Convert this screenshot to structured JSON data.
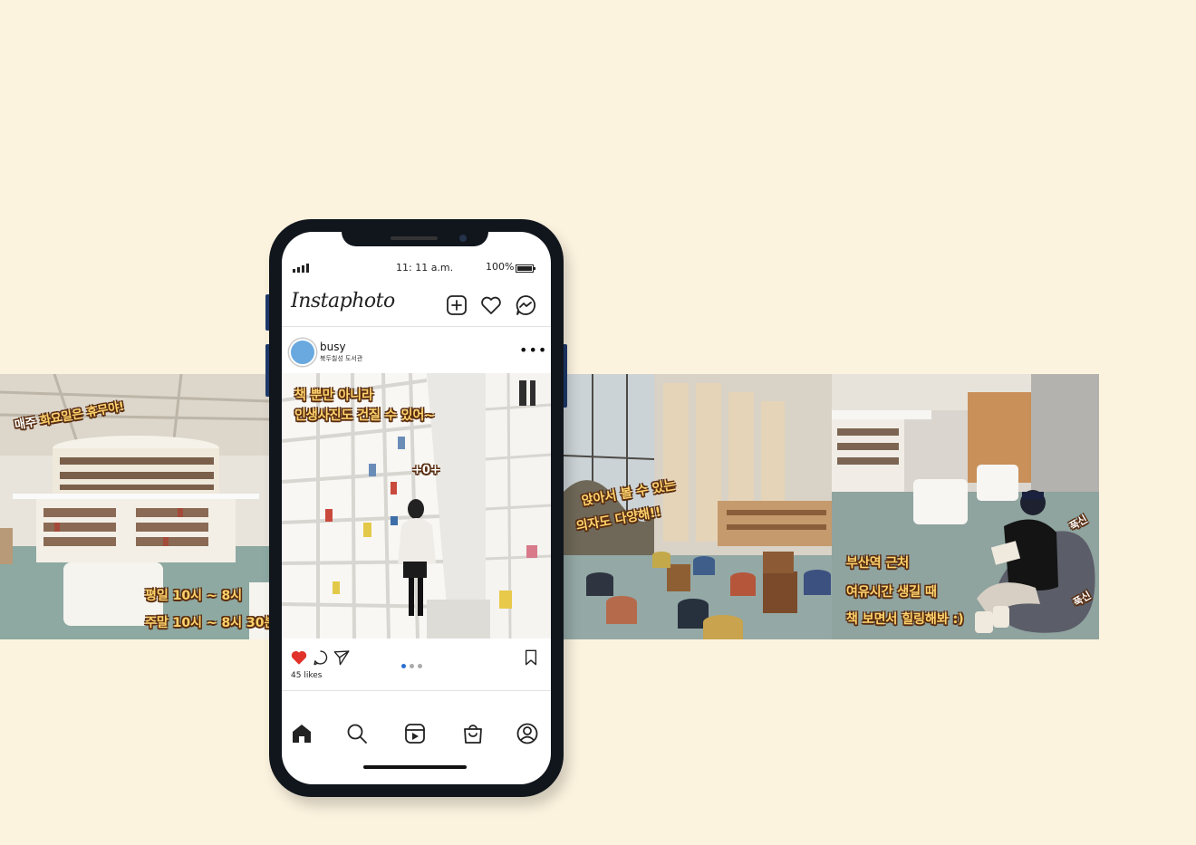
{
  "photos": {
    "photo1": {
      "line1_a": "매주 ",
      "line1_b": "화요일은 휴무야!",
      "hours1": "평일 10시 ~ 8시",
      "hours2": "주말 10시 ~ 8시 30분"
    },
    "photo3": {
      "line1": "앉아서 볼 수 있는",
      "line2": "의자도 다양해!!"
    },
    "photo4": {
      "line1": "부산역 근처",
      "line2": "여유시간 생길 때",
      "line3": "책 보면서 힐링해봐 :)",
      "tag1": "푹신",
      "tag2": "푹신"
    }
  },
  "phone": {
    "status": {
      "time": "11: 11 a.m.",
      "battery": "100%"
    },
    "app": {
      "logo": "Instaphoto"
    },
    "post": {
      "username": "busy",
      "location": "북두칠성 도서관",
      "caption1": "책 뿐만 아니라",
      "caption2": "인생사진도 건질 수 있어~",
      "sticker": "+0+",
      "likes": "45 likes"
    },
    "carousel": {
      "page": 1,
      "total": 3
    }
  },
  "colors": {
    "background": "#fcf3df",
    "like_red": "#e0322b",
    "dot_active": "#2b6fd1",
    "caption_yellow": "#ffd36b"
  }
}
